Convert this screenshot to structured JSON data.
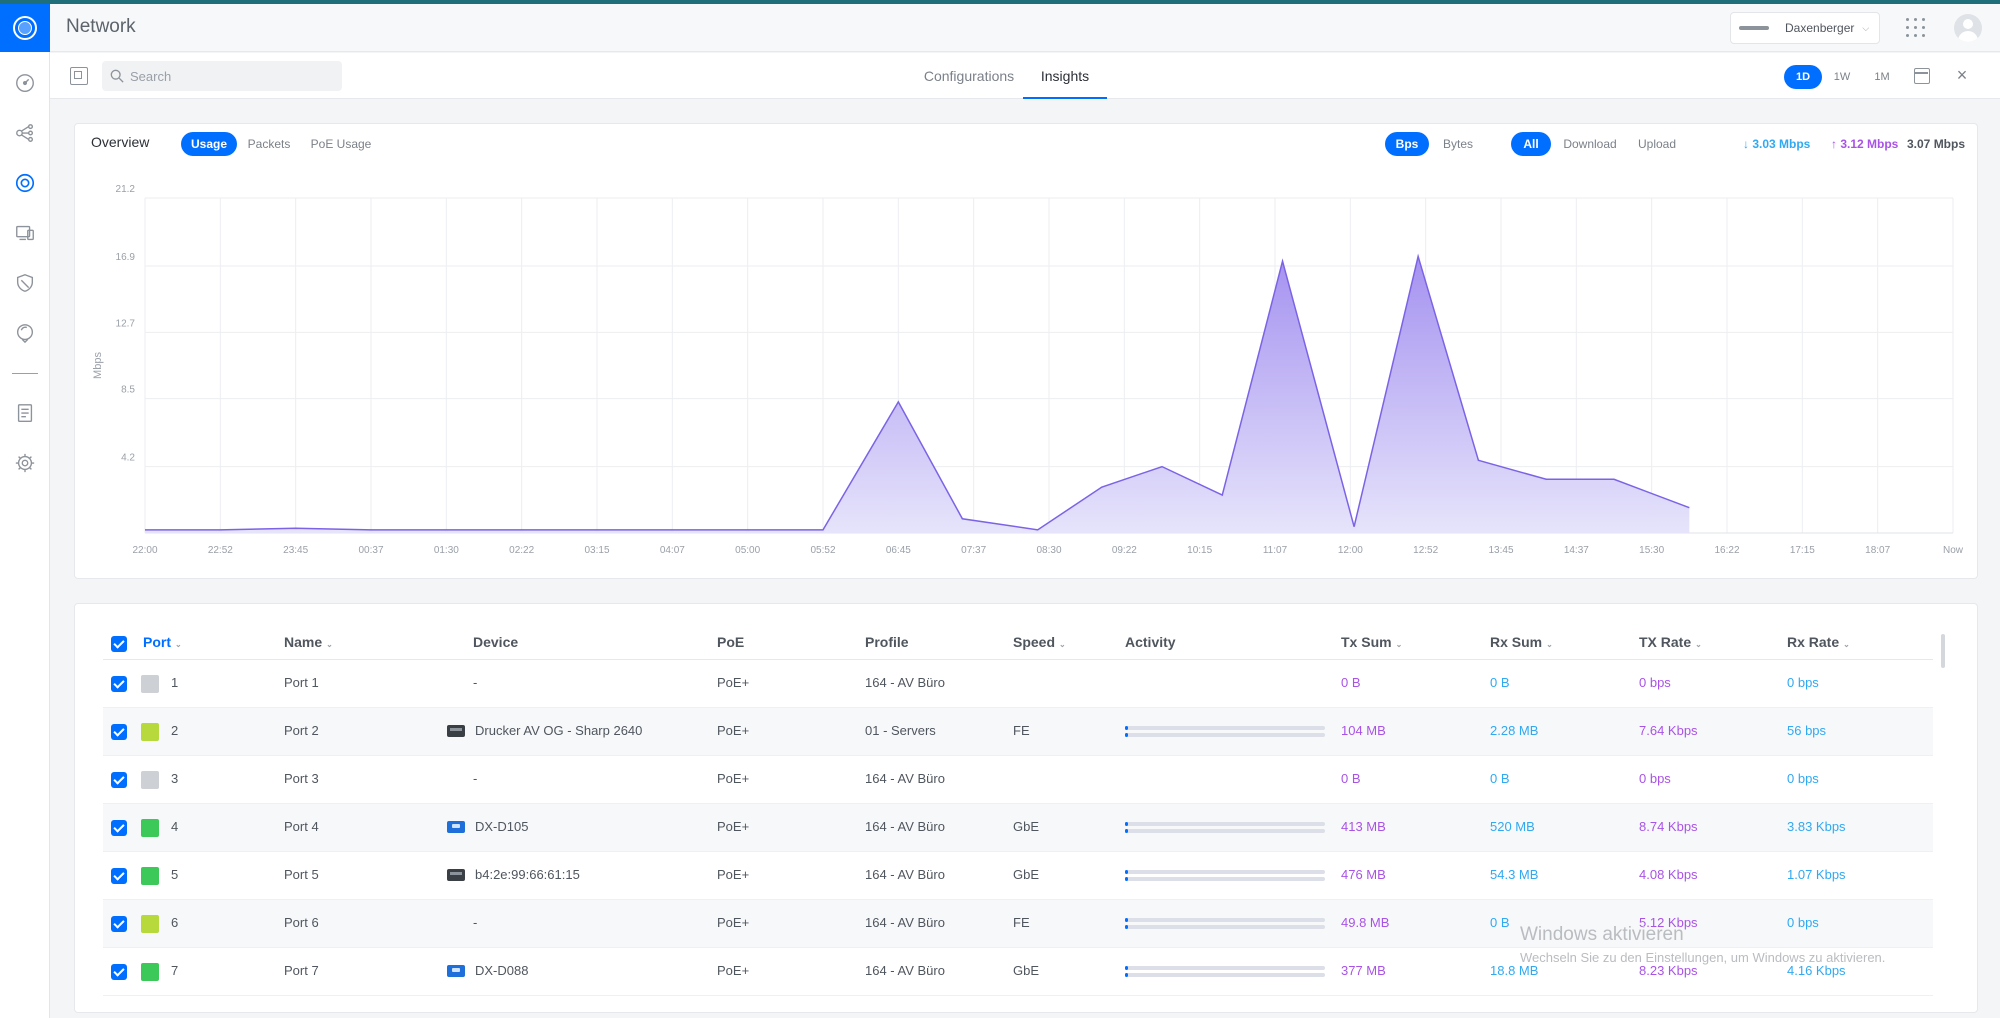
{
  "app": {
    "title": "Network"
  },
  "header": {
    "site": "Daxenberger"
  },
  "search": {
    "placeholder": "Search"
  },
  "tabs": [
    {
      "label": "Configurations"
    },
    {
      "label": "Insights"
    }
  ],
  "range": [
    {
      "label": "1D"
    },
    {
      "label": "1W"
    },
    {
      "label": "1M"
    }
  ],
  "overview": {
    "label": "Overview",
    "metrics": [
      {
        "label": "Usage"
      },
      {
        "label": "Packets"
      },
      {
        "label": "PoE Usage"
      }
    ],
    "units": [
      {
        "label": "Bps"
      },
      {
        "label": "Bytes"
      }
    ],
    "direction": [
      {
        "label": "All"
      },
      {
        "label": "Download"
      },
      {
        "label": "Upload"
      }
    ],
    "legend": {
      "download": "↓ 3.03 Mbps",
      "upload": "↑ 3.12 Mbps",
      "total": "3.07 Mbps"
    }
  },
  "chart_data": {
    "type": "area",
    "ylabel": "Mbps",
    "ylim": [
      0,
      21.2
    ],
    "yticks": [
      "4.2",
      "8.5",
      "12.7",
      "16.9",
      "21.2"
    ],
    "ytick_values": [
      4.2,
      8.5,
      12.7,
      16.9,
      21.2
    ],
    "xticks": [
      "22:00",
      "22:52",
      "23:45",
      "00:37",
      "01:30",
      "02:22",
      "03:15",
      "04:07",
      "05:00",
      "05:52",
      "06:45",
      "07:37",
      "08:30",
      "09:22",
      "10:15",
      "11:07",
      "12:00",
      "12:52",
      "13:45",
      "14:37",
      "15:30",
      "16:22",
      "17:15",
      "18:07",
      "Now"
    ],
    "x": [
      0,
      1,
      2,
      3,
      4,
      5,
      6,
      7,
      8,
      9,
      10,
      10.85,
      11.85,
      12.7,
      13.5,
      14.3,
      15.1,
      16.05,
      16.9,
      17.7,
      18.6,
      19.5,
      20.5,
      21.4,
      22.3,
      23,
      24
    ],
    "values": [
      0.2,
      0.2,
      0.3,
      0.2,
      0.2,
      0.2,
      0.2,
      0.2,
      0.2,
      0.2,
      8.3,
      0.9,
      0.2,
      2.9,
      4.2,
      2.4,
      17.2,
      0.4,
      17.5,
      4.6,
      3.4,
      3.4,
      1.6
    ],
    "series": [
      {
        "values": [
          0.2,
          0.2,
          0.3,
          0.2,
          0.2,
          0.2,
          0.2,
          0.2,
          0.2,
          0.2,
          8.3,
          0.9,
          0.2,
          2.9,
          4.2,
          2.4,
          17.2,
          0.4,
          17.5,
          4.6,
          3.4,
          3.4,
          1.6
        ]
      }
    ],
    "colors": {
      "line": "#7c63e6",
      "fill_top": "#a592f0",
      "fill_bottom": "#e6e4fb"
    }
  },
  "table": {
    "headers": {
      "port": "Port",
      "name": "Name",
      "device": "Device",
      "poe": "PoE",
      "profile": "Profile",
      "speed": "Speed",
      "activity": "Activity",
      "tx_sum": "Tx Sum",
      "rx_sum": "Rx Sum",
      "tx_rate": "TX Rate",
      "rx_rate": "Rx Rate"
    },
    "rows": [
      {
        "port": "1",
        "name": "Port 1",
        "device": "-",
        "device_icon": "",
        "poe": "PoE+",
        "profile": "164 - AV Büro",
        "speed": "",
        "tx_sum": "0 B",
        "rx_sum": "0 B",
        "tx_rate": "0 bps",
        "rx_rate": "0 bps",
        "color": "#cdd0d5",
        "activity": false
      },
      {
        "port": "2",
        "name": "Port 2",
        "device": "Drucker AV OG - Sharp 2640",
        "device_icon": "printer",
        "poe": "PoE+",
        "profile": "01 - Servers",
        "speed": "FE",
        "tx_sum": "104 MB",
        "rx_sum": "2.28 MB",
        "tx_rate": "7.64 Kbps",
        "rx_rate": "56 bps",
        "color": "#b8d93c",
        "activity": true
      },
      {
        "port": "3",
        "name": "Port 3",
        "device": "-",
        "device_icon": "",
        "poe": "PoE+",
        "profile": "164 - AV Büro",
        "speed": "",
        "tx_sum": "0 B",
        "rx_sum": "0 B",
        "tx_rate": "0 bps",
        "rx_rate": "0 bps",
        "color": "#cdd0d5",
        "activity": false
      },
      {
        "port": "4",
        "name": "Port 4",
        "device": "DX-D105",
        "device_icon": "ap",
        "poe": "PoE+",
        "profile": "164 - AV Büro",
        "speed": "GbE",
        "tx_sum": "413 MB",
        "rx_sum": "520 MB",
        "tx_rate": "8.74 Kbps",
        "rx_rate": "3.83 Kbps",
        "color": "#3cc95a",
        "activity": true
      },
      {
        "port": "5",
        "name": "Port 5",
        "device": "b4:2e:99:66:61:15",
        "device_icon": "printer",
        "poe": "PoE+",
        "profile": "164 - AV Büro",
        "speed": "GbE",
        "tx_sum": "476 MB",
        "rx_sum": "54.3 MB",
        "tx_rate": "4.08 Kbps",
        "rx_rate": "1.07 Kbps",
        "color": "#3cc95a",
        "activity": true
      },
      {
        "port": "6",
        "name": "Port 6",
        "device": "-",
        "device_icon": "",
        "poe": "PoE+",
        "profile": "164 - AV Büro",
        "speed": "FE",
        "tx_sum": "49.8 MB",
        "rx_sum": "0 B",
        "tx_rate": "5.12 Kbps",
        "rx_rate": "0 bps",
        "color": "#b8d93c",
        "activity": true
      },
      {
        "port": "7",
        "name": "Port 7",
        "device": "DX-D088",
        "device_icon": "ap",
        "poe": "PoE+",
        "profile": "164 - AV Büro",
        "speed": "GbE",
        "tx_sum": "377 MB",
        "rx_sum": "18.8 MB",
        "tx_rate": "8.23 Kbps",
        "rx_rate": "4.16 Kbps",
        "color": "#3cc95a",
        "activity": true
      }
    ]
  },
  "watermark": {
    "title": "Windows aktivieren",
    "subtitle": "Wechseln Sie zu den Einstellungen, um Windows zu aktivieren."
  }
}
